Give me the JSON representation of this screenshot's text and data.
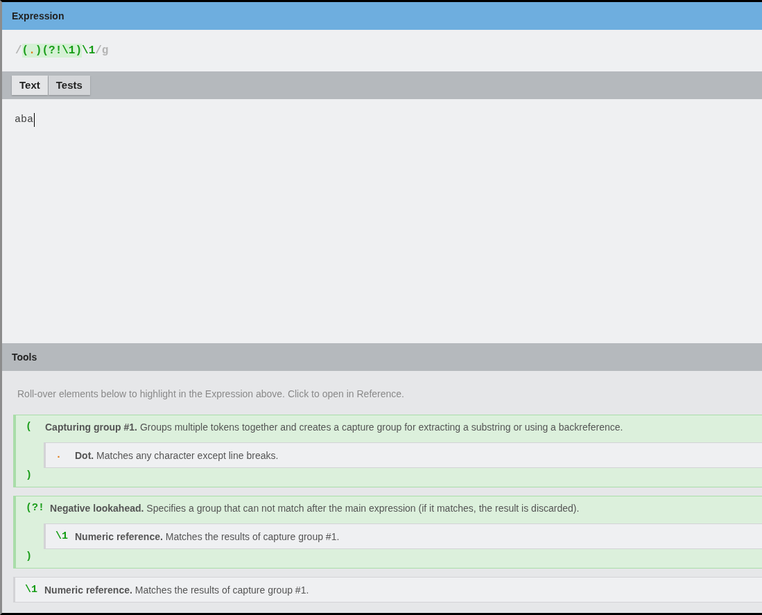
{
  "expression_panel": {
    "title": "Expression",
    "tokens": [
      {
        "kind": "delimiter",
        "text": "/",
        "highlighted": false
      },
      {
        "kind": "group",
        "text": "(",
        "highlighted": true
      },
      {
        "kind": "dot",
        "text": ".",
        "highlighted": true
      },
      {
        "kind": "group",
        "text": ")",
        "highlighted": true
      },
      {
        "kind": "group",
        "text": "(?!",
        "highlighted": true
      },
      {
        "kind": "backref",
        "text": "\\1",
        "highlighted": true
      },
      {
        "kind": "group",
        "text": ")",
        "highlighted": true
      },
      {
        "kind": "backref",
        "text": "\\1",
        "highlighted": false
      },
      {
        "kind": "delimiter",
        "text": "/g",
        "highlighted": false
      }
    ]
  },
  "tabs": [
    {
      "label": "Text",
      "selected": true
    },
    {
      "label": "Tests",
      "selected": false
    }
  ],
  "text_input": {
    "value": "aba"
  },
  "tools_panel": {
    "title": "Tools",
    "hint": "Roll-over elements below to highlight in the Expression above. Click to open in Reference.",
    "explanations": [
      {
        "kind": "group",
        "open_token": {
          "kind": "group",
          "text": "("
        },
        "text": "**Capturing group #1.** Groups multiple tokens together and creates a capture group for extracting a substring or using a backreference.",
        "close_token": {
          "kind": "group",
          "text": ")"
        },
        "children": [
          {
            "kind": "token",
            "token": {
              "kind": "dot",
              "text": "."
            },
            "text": "**Dot.** Matches any character except line breaks."
          }
        ]
      },
      {
        "kind": "group",
        "open_token": {
          "kind": "group",
          "text": "(?!"
        },
        "text": "**Negative lookahead.** Specifies a group that can not match after the main expression (if it matches, the result is discarded).",
        "close_token": {
          "kind": "group",
          "text": ")"
        },
        "children": [
          {
            "kind": "token",
            "token": {
              "kind": "backref",
              "text": "\\1"
            },
            "text": "**Numeric reference.** Matches the results of capture group #1."
          }
        ]
      },
      {
        "kind": "token",
        "token": {
          "kind": "backref",
          "text": "\\1"
        },
        "text": "**Numeric reference.** Matches the results of capture group #1."
      }
    ]
  }
}
